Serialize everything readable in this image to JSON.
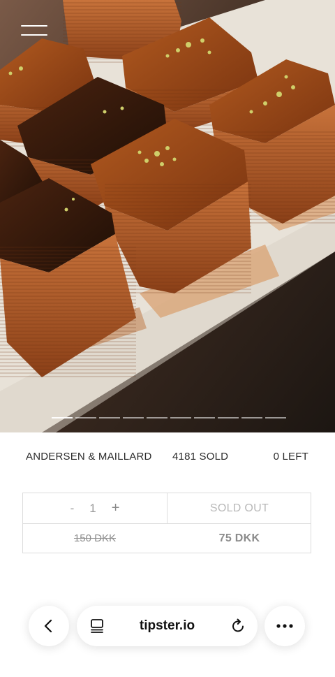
{
  "product": {
    "brand": "ANDERSEN & MAILLARD",
    "sold_text": "4181 SOLD",
    "left_text": "0 LEFT"
  },
  "gallery": {
    "slide_count": 10,
    "active_slide": 1
  },
  "purchase": {
    "minus_label": "-",
    "quantity": "1",
    "plus_label": "+",
    "button_label": "SOLD OUT",
    "original_price": "150 DKK",
    "sale_price": "75 DKK"
  },
  "browser": {
    "url": "tipster.io"
  },
  "icons": {
    "menu": "hamburger-menu-icon",
    "back": "chevron-left-icon",
    "tabs": "tabs-icon",
    "reload": "reload-icon",
    "more": "ellipsis-icon"
  }
}
